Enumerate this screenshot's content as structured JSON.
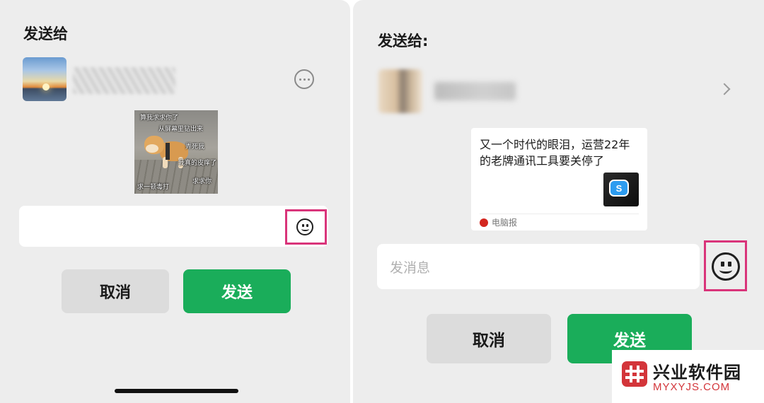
{
  "left_panel": {
    "title": "发送给",
    "meme_captions": [
      "算我求求你了",
      "从屏幕里钻出来",
      "弄死我",
      "我真的皮痒了",
      "求一顿毒打",
      "求求你"
    ],
    "cancel_label": "取消",
    "send_label": "发送"
  },
  "right_panel": {
    "title": "发送给:",
    "card": {
      "title": "又一个时代的眼泪，运营22年的老牌通讯工具要关停了",
      "source": "电脑报"
    },
    "input_placeholder": "发消息",
    "cancel_label": "取消",
    "send_label": "发送"
  },
  "watermark": {
    "brand": "兴业软件园",
    "domain": "MYXYJS.COM"
  },
  "colors": {
    "send_green": "#1aad5a",
    "highlight_pink": "#d9347a",
    "panel_bg": "#ededed"
  },
  "icons": [
    "more-icon",
    "emoji-icon",
    "chevron-right-icon",
    "skype-icon"
  ]
}
